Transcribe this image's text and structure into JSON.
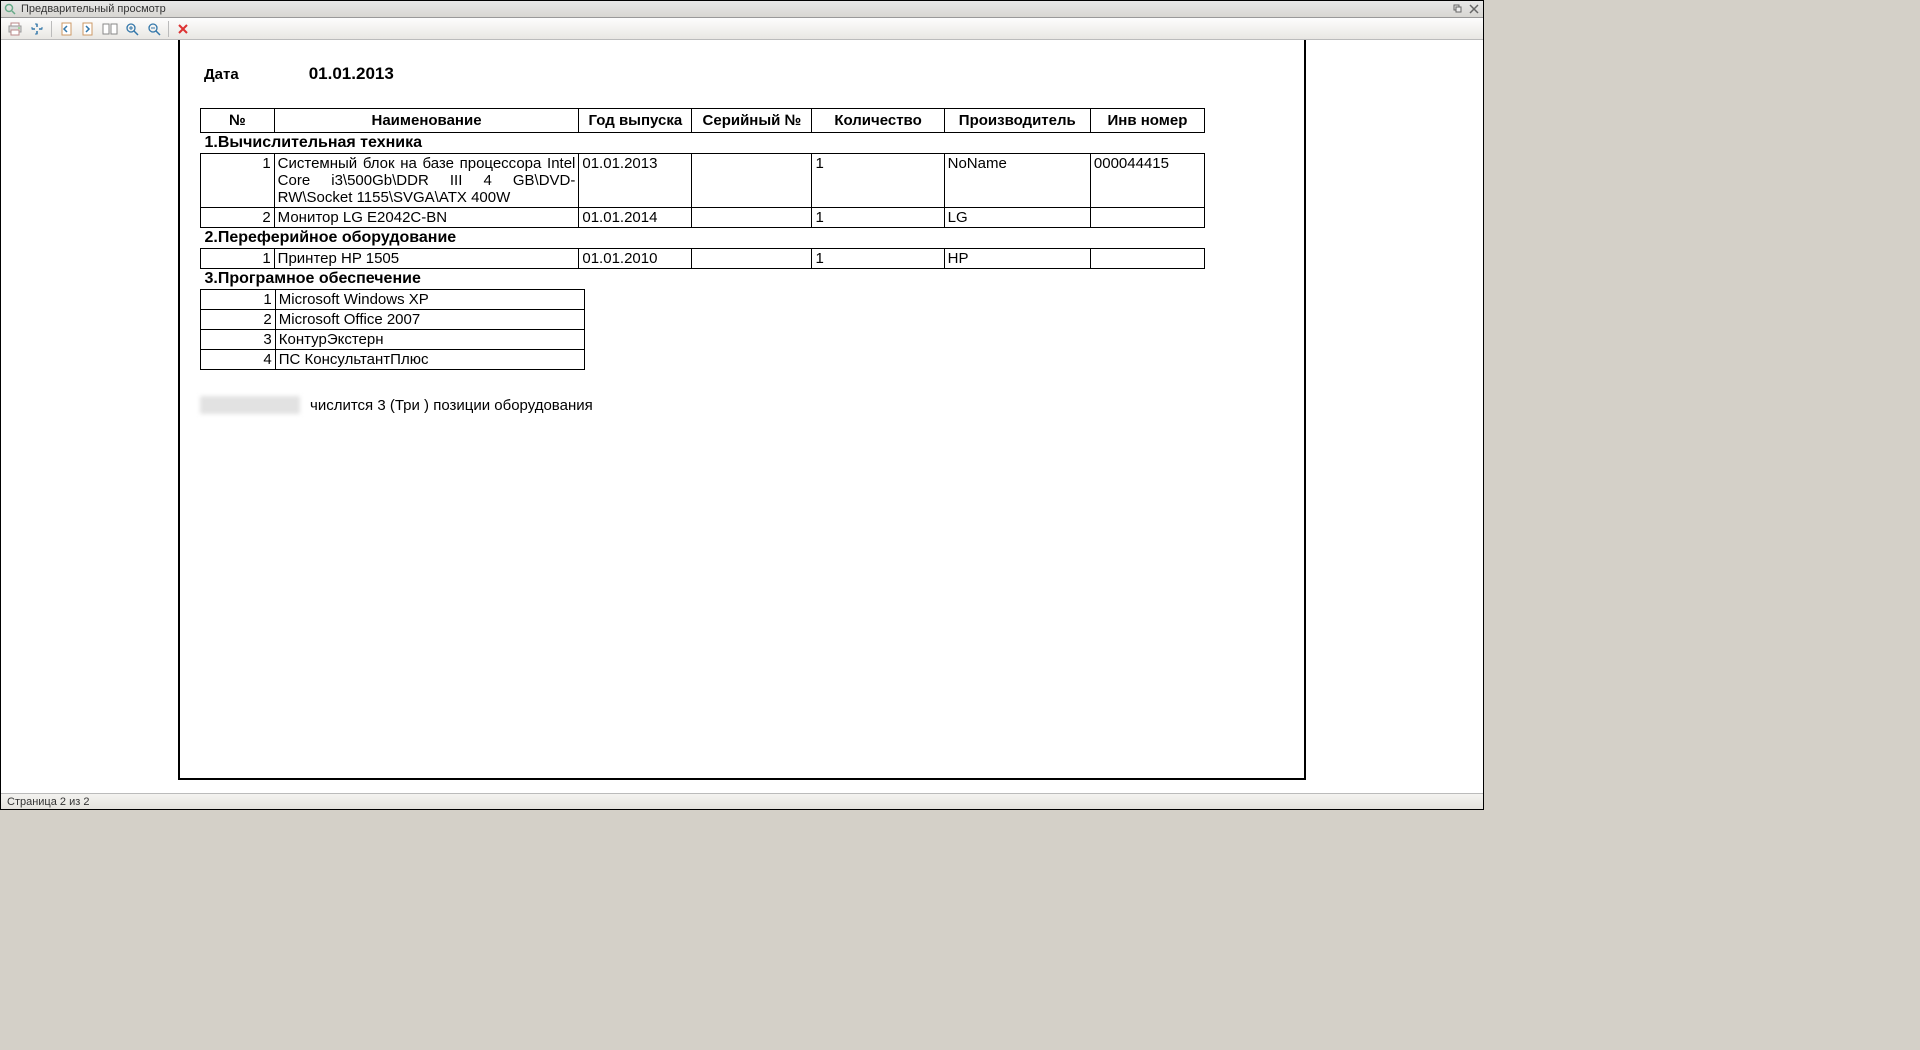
{
  "window": {
    "title": "Предварительный просмотр"
  },
  "toolbar": {
    "print": "print",
    "fit": "fit",
    "prev": "prev-page",
    "next": "next-page",
    "multi": "multi-page",
    "zoom_in": "zoom-in",
    "zoom_out": "zoom-out",
    "close": "close"
  },
  "report": {
    "date_label": "Дата",
    "date_value": "01.01.2013",
    "headers": {
      "num": "№",
      "name": "Наименование",
      "year": "Год выпуска",
      "serial": "Серийный №",
      "qty": "Количество",
      "mfr": "Производитель",
      "inv": "Инв номер"
    },
    "sections": [
      {
        "title": "1.Вычислительная техника",
        "rows": [
          {
            "num": "1",
            "name": "Системный блок на базе процессора Intel Core i3\\500Gb\\DDR III 4 GB\\DVD-RW\\Socket 1155\\SVGA\\ATX 400W",
            "year": "01.01.2013",
            "serial": "",
            "qty": "1",
            "mfr": "NoName",
            "inv": "000044415"
          },
          {
            "num": "2",
            "name": "Монитор LG E2042C-BN",
            "year": "01.01.2014",
            "serial": "",
            "qty": "1",
            "mfr": "LG",
            "inv": ""
          }
        ]
      },
      {
        "title": "2.Переферийное оборудование",
        "rows": [
          {
            "num": "1",
            "name": "Принтер HP 1505",
            "year": "01.01.2010",
            "serial": "",
            "qty": "1",
            "mfr": "HP",
            "inv": ""
          }
        ]
      }
    ],
    "software_section": {
      "title": "3.Програмное обеспечение",
      "rows": [
        {
          "num": "1",
          "name": "Microsoft Windows XP"
        },
        {
          "num": "2",
          "name": "Microsoft Office 2007"
        },
        {
          "num": "3",
          "name": "КонтурЭкстерн"
        },
        {
          "num": "4",
          "name": "ПС КонсультантПлюс"
        }
      ]
    },
    "footer_text": "числится 3 (Три ) позиции оборудования"
  },
  "status": {
    "page_info": "Страница 2 из 2"
  }
}
